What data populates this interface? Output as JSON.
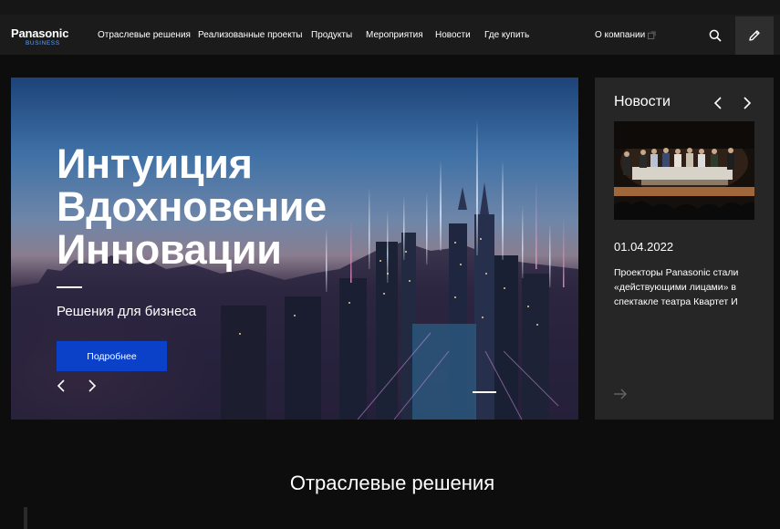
{
  "header": {
    "logo": {
      "brand": "Panasonic",
      "sub": "BUSINESS"
    },
    "nav": [
      "Отраслевые решения",
      "Реализованные проекты",
      "Продукты",
      "Мероприятия",
      "Новости",
      "Где купить"
    ],
    "about": "О компании",
    "icons": {
      "search": "search-icon",
      "edit": "pencil-icon",
      "external": "external-link-icon"
    }
  },
  "hero": {
    "lines": [
      "Интуиция",
      "Вдохновение",
      "Инновации"
    ],
    "subtitle": "Решения для бизнеса",
    "button": "Подробнее",
    "button_color": "#0b41c9"
  },
  "news": {
    "title": "Новости",
    "date": "01.04.2022",
    "text": "Проекторы Panasonic стали «действующими лицами» в спектакле театра Квартет И"
  },
  "section": {
    "title": "Отраслевые решения"
  }
}
